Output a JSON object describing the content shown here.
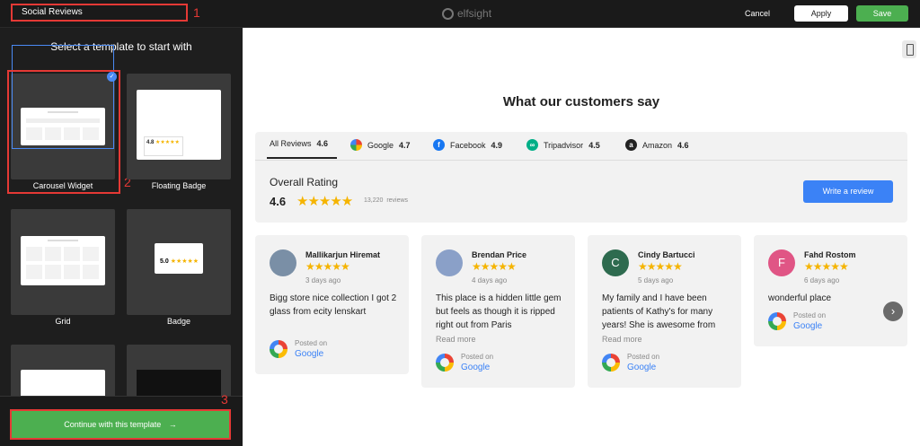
{
  "topbar": {
    "widget_name": "Social Reviews",
    "brand": "elfsight",
    "cancel": "Cancel",
    "apply": "Apply",
    "save": "Save"
  },
  "annotations": [
    "1",
    "2",
    "3"
  ],
  "sidebar": {
    "title": "Select a template to start with",
    "templates": [
      {
        "label": "Carousel Widget",
        "selected": true
      },
      {
        "label": "Floating Badge"
      },
      {
        "label": "Grid"
      },
      {
        "label": "Badge"
      }
    ],
    "badge_preview": {
      "floating_rating": "4.8",
      "badge_rating": "5.0"
    },
    "continue": "Continue with this template",
    "continue_arrow": "→"
  },
  "preview": {
    "heading": "What our customers say",
    "tabs": [
      {
        "label": "All Reviews",
        "rating": "4.6"
      },
      {
        "label": "Google",
        "rating": "4.7",
        "icon": "google-icon"
      },
      {
        "label": "Facebook",
        "rating": "4.9",
        "icon": "facebook-icon"
      },
      {
        "label": "Tripadvisor",
        "rating": "4.5",
        "icon": "tripadvisor-icon"
      },
      {
        "label": "Amazon",
        "rating": "4.6",
        "icon": "amazon-icon"
      }
    ],
    "overall_label": "Overall Rating",
    "overall_rating": "4.6",
    "review_count": "13,220",
    "reviews_word": "reviews",
    "write_review": "Write a review",
    "reviews": [
      {
        "name": "Mallikarjun Hiremat",
        "date": "3 days ago",
        "text": "Bigg store nice collection I got 2 glass from ecity lenskart",
        "read_more": "",
        "posted_on": "Posted on",
        "source": "Google",
        "avatar_color": "#7a8fa6",
        "initial": ""
      },
      {
        "name": "Brendan Price",
        "date": "4 days ago",
        "text": "This place is a hidden little gem but feels as though it is ripped right out from Paris",
        "read_more": "Read more",
        "posted_on": "Posted on",
        "source": "Google",
        "avatar_color": "#8aa0c8",
        "initial": ""
      },
      {
        "name": "Cindy Bartucci",
        "date": "5 days ago",
        "text": "My family and I have been patients of Kathy's for many years! She is awesome from",
        "read_more": "Read more",
        "posted_on": "Posted on",
        "source": "Google",
        "avatar_color": "#2e6b4f",
        "initial": "C"
      },
      {
        "name": "Fahd Rostom",
        "date": "6 days ago",
        "text": "wonderful place",
        "read_more": "",
        "posted_on": "Posted on",
        "source": "Google",
        "avatar_color": "#e05585",
        "initial": "F"
      }
    ],
    "stars": "★★★★★"
  },
  "colors": {
    "accent_green": "#4caf50",
    "accent_blue": "#3b82f6",
    "annotation_red": "#e53935",
    "star": "#f5b400"
  }
}
